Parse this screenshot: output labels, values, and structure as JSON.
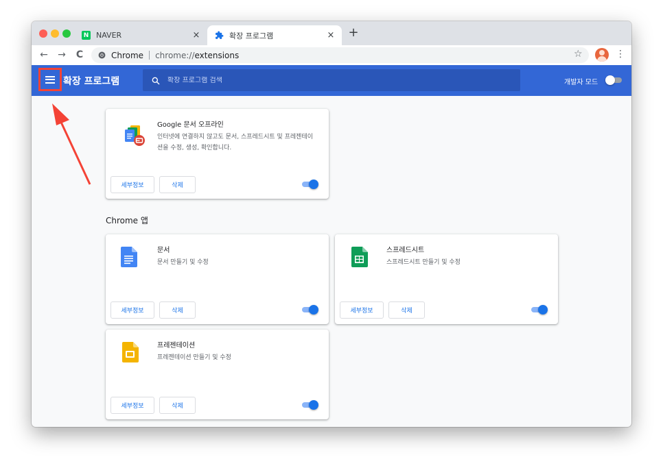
{
  "browser": {
    "tabs": [
      {
        "title": "NAVER",
        "icon": "naver-icon",
        "close": "×"
      },
      {
        "title": "확장 프로그램",
        "icon": "puzzle-icon",
        "close": "×"
      }
    ],
    "new_tab": "+",
    "omnibox": {
      "site": "Chrome",
      "url_prefix": "chrome://",
      "url_path": "extensions"
    },
    "nav": {
      "back": "←",
      "forward": "→",
      "reload": "C"
    },
    "star": "☆",
    "menu": "⋮"
  },
  "header": {
    "title": "확장 프로그램",
    "search_placeholder": "확장 프로그램 검색",
    "dev_mode_label": "개발자 모드",
    "dev_mode_on": false,
    "accent": "#3367d6"
  },
  "extensions": [
    {
      "name": "Google 문서 오프라인",
      "description": "인터넷에 연결하지 않고도 문서, 스프레드시트 및 프레젠테이션을 수정, 생성, 확인합니다.",
      "details_label": "세부정보",
      "remove_label": "삭제",
      "enabled": true,
      "icon": "google-docs-offline-icon"
    }
  ],
  "apps_section": {
    "title": "Chrome 앱",
    "apps": [
      {
        "name": "문서",
        "description": "문서 만들기 및 수정",
        "details_label": "세부정보",
        "remove_label": "삭제",
        "enabled": true,
        "icon": "docs-icon",
        "color": "#4285f4"
      },
      {
        "name": "스프레드시트",
        "description": "스프레드시트 만들기 및 수정",
        "details_label": "세부정보",
        "remove_label": "삭제",
        "enabled": true,
        "icon": "sheets-icon",
        "color": "#0f9d58"
      },
      {
        "name": "프레젠테이션",
        "description": "프레젠테이션 만들기 및 수정",
        "details_label": "세부정보",
        "remove_label": "삭제",
        "enabled": true,
        "icon": "slides-icon",
        "color": "#f4b400"
      }
    ]
  },
  "annotation": {
    "color": "#f44336",
    "icon": "red-arrow"
  }
}
